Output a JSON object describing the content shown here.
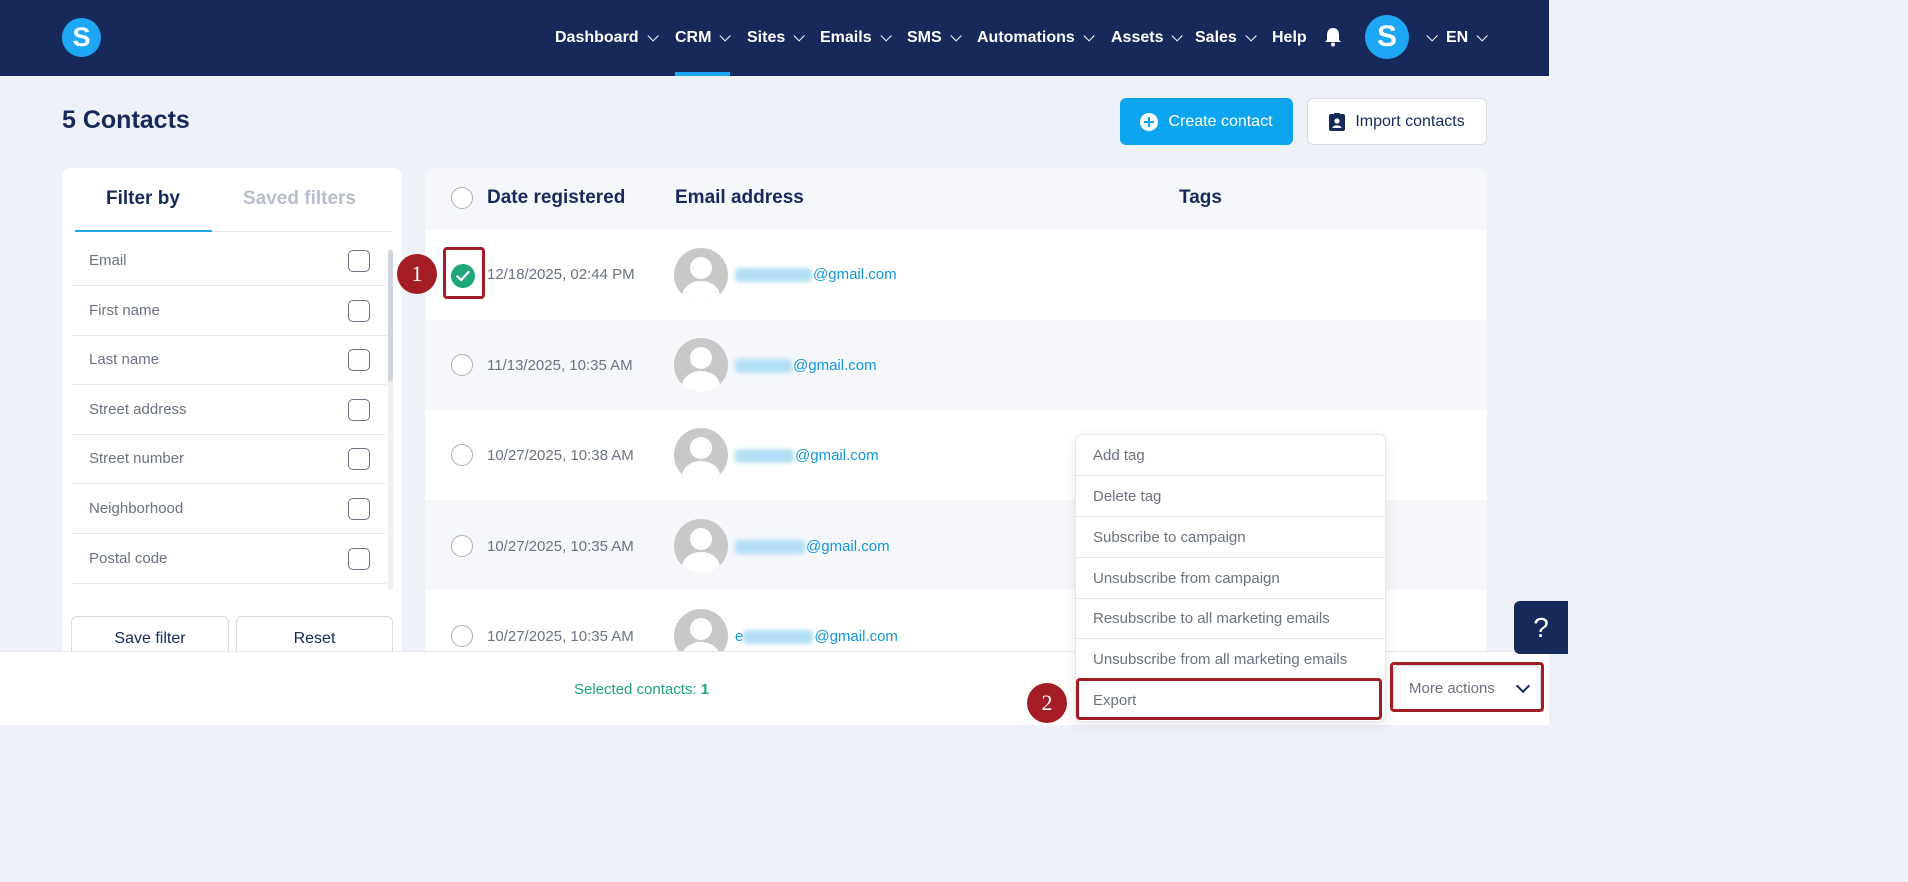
{
  "app": {
    "logo_letter": "S",
    "avatar_letter": "S",
    "language": "EN"
  },
  "nav": [
    {
      "label": "Dashboard",
      "has_menu": true
    },
    {
      "label": "CRM",
      "has_menu": true,
      "active": true
    },
    {
      "label": "Sites",
      "has_menu": true
    },
    {
      "label": "Emails",
      "has_menu": true
    },
    {
      "label": "SMS",
      "has_menu": true
    },
    {
      "label": "Automations",
      "has_menu": true
    },
    {
      "label": "Assets",
      "has_menu": true
    },
    {
      "label": "Sales",
      "has_menu": true
    },
    {
      "label": "Help",
      "has_menu": false
    }
  ],
  "header": {
    "title": "5 Contacts",
    "create_label": "Create contact",
    "import_label": "Import contacts"
  },
  "filters": {
    "tab_active": "Filter by",
    "tab_inactive": "Saved filters",
    "fields": [
      "Email",
      "First name",
      "Last name",
      "Street address",
      "Street number",
      "Neighborhood",
      "Postal code"
    ],
    "save_label": "Save filter",
    "reset_label": "Reset"
  },
  "table": {
    "columns": {
      "date": "Date registered",
      "email": "Email address",
      "tags": "Tags"
    },
    "rows": [
      {
        "date": "12/18/2025, 02:44 PM",
        "email_domain": "@gmail.com",
        "selected": true
      },
      {
        "date": "11/13/2025, 10:35 AM",
        "email_domain": "@gmail.com",
        "selected": false
      },
      {
        "date": "10/27/2025, 10:38 AM",
        "email_domain": "@gmail.com",
        "selected": false
      },
      {
        "date": "10/27/2025, 10:35 AM",
        "email_domain": "@gmail.com",
        "selected": false
      },
      {
        "date": "10/27/2025, 10:35 AM",
        "email_prefix_visible": "e",
        "email_domain": "@gmail.com",
        "selected": false
      }
    ]
  },
  "bottom": {
    "selected_label": "Selected contacts:",
    "selected_count": "1",
    "more_actions_label": "More actions"
  },
  "actions_menu": [
    "Add tag",
    "Delete tag",
    "Subscribe to campaign",
    "Unsubscribe from campaign",
    "Resubscribe to all marketing emails",
    "Unsubscribe from all marketing emails",
    "Export"
  ],
  "help_glyph": "?",
  "annotations": [
    "1",
    "2"
  ],
  "colors": {
    "navbar": "#16295a",
    "accent": "#1ea7f5",
    "success": "#1fa67a",
    "annotation": "#a51d24"
  }
}
